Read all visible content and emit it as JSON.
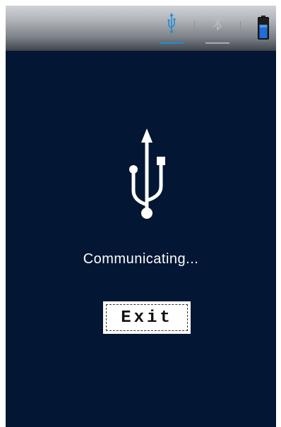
{
  "topbar": {
    "tabs": [
      {
        "icon": "usb-icon",
        "active": true,
        "color": "#1a8fd6"
      },
      {
        "icon": "bluetooth-icon",
        "active": false,
        "color": "#a8abb0"
      }
    ],
    "battery": {
      "icon": "battery-icon",
      "fill_color": "#1e6fd9"
    }
  },
  "main": {
    "icon": "usb-icon",
    "status_text": "Communicating...",
    "exit_label": "Exit"
  },
  "colors": {
    "background": "#031634",
    "accent": "#1a8fd6"
  }
}
